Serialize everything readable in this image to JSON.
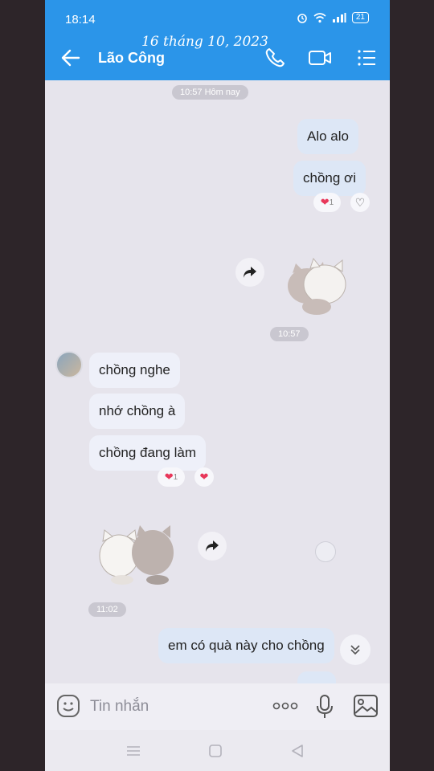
{
  "status": {
    "time": "18:14",
    "battery": "21"
  },
  "overlay": {
    "date_stamp": "16 tháng 10, 2023"
  },
  "header": {
    "contact_name": "Lão Công"
  },
  "chat": {
    "time_today": "10:57 Hôm nay",
    "msg_alo": "Alo alo",
    "msg_chong_oi": "chồng ơi",
    "reaction_count_1": "1",
    "time_1057": "10:57",
    "msg_chong_nghe": "chồng nghe",
    "msg_nho_chong": "nhớ chồng à",
    "msg_chong_dang_lam": "chồng đang làm",
    "reaction_count_2": "1",
    "time_1102": "11:02",
    "msg_em_co_qua": "em có quà này cho chồng",
    "msg_partial": ". . ."
  },
  "input": {
    "placeholder": "Tin nhắn"
  },
  "colors": {
    "accent": "#2b95e9",
    "heart": "#e8375a"
  }
}
